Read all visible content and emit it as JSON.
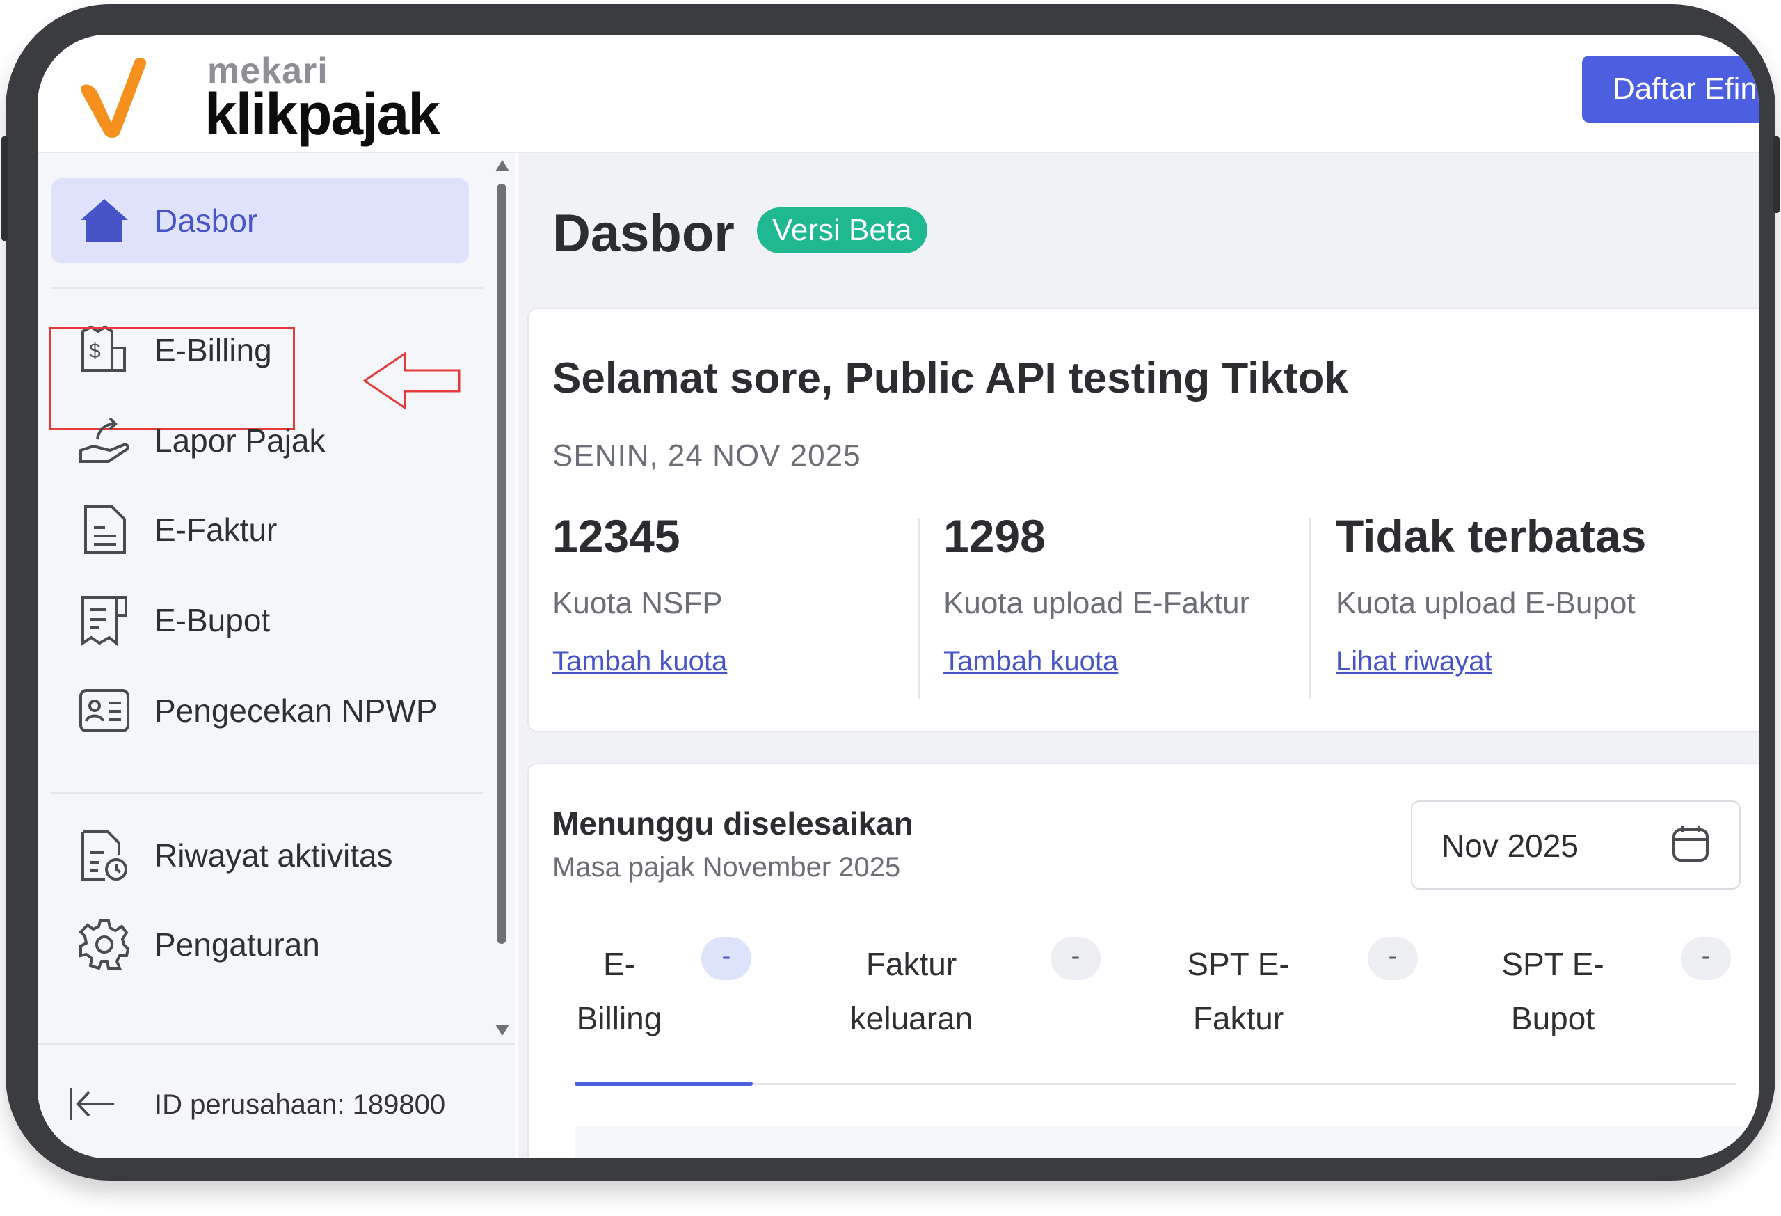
{
  "header": {
    "logo_small": "mekari",
    "logo_big": "klikpajak",
    "cta_label": "Daftar Efin"
  },
  "sidebar": {
    "items": [
      {
        "label": "Dasbor",
        "icon": "home-icon",
        "active": true
      },
      {
        "label": "E-Billing",
        "icon": "billing-icon",
        "active": false
      },
      {
        "label": "Lapor Pajak",
        "icon": "upload-report-icon",
        "active": false
      },
      {
        "label": "E-Faktur",
        "icon": "document-icon",
        "active": false
      },
      {
        "label": "E-Bupot",
        "icon": "receipt-icon",
        "active": false
      },
      {
        "label": "Pengecekan NPWP",
        "icon": "id-card-icon",
        "active": false
      },
      {
        "label": "Riwayat aktivitas",
        "icon": "history-icon",
        "active": false
      },
      {
        "label": "Pengaturan",
        "icon": "gear-icon",
        "active": false
      }
    ],
    "company_id": "ID perusahaan: 189800"
  },
  "main": {
    "title": "Dasbor",
    "badge": "Versi Beta",
    "greeting": "Selamat sore, Public API testing Tiktok",
    "date": "SENIN, 24 NOV 2025",
    "stats": [
      {
        "value": "12345",
        "caption": "Kuota NSFP",
        "link": "Tambah kuota"
      },
      {
        "value": "1298",
        "caption": "Kuota upload E-Faktur",
        "link": "Tambah kuota"
      },
      {
        "value": "Tidak terbatas",
        "caption": "Kuota upload E-Bupot",
        "link": "Lihat riwayat"
      }
    ],
    "pending": {
      "title": "Menunggu diselesaikan",
      "subtitle": "Masa pajak November 2025",
      "month": "Nov 2025",
      "tabs": [
        {
          "line1": "E-",
          "line2": "Billing",
          "badge": "-"
        },
        {
          "line1": "Faktur",
          "line2": "keluaran",
          "badge": "-"
        },
        {
          "line1": "SPT E-",
          "line2": "Faktur",
          "badge": "-"
        },
        {
          "line1": "SPT E-",
          "line2": "Bupot",
          "badge": "-"
        }
      ]
    }
  },
  "colors": {
    "accent": "#4c5fe0",
    "beta_badge": "#1fb890",
    "highlight": "#e53a3a",
    "logo_orange": "#f5901e"
  }
}
